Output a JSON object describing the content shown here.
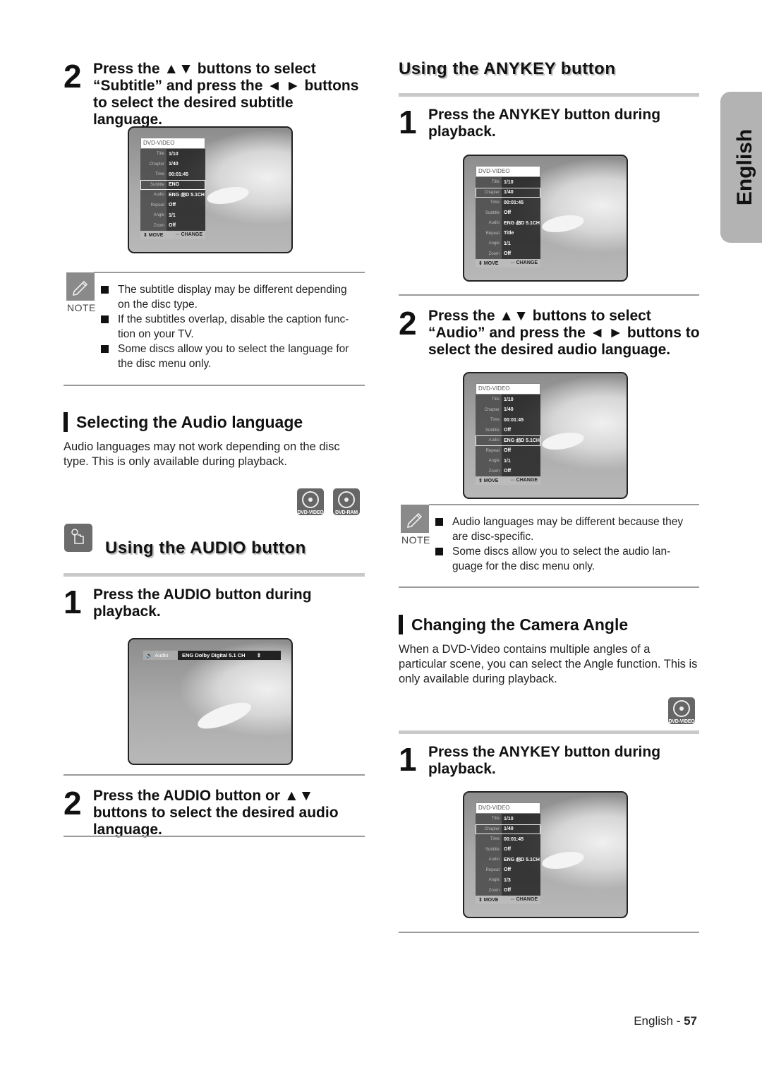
{
  "side_tab": {
    "label": "English"
  },
  "left_column": {
    "step2_subtitle": {
      "number": "2",
      "text": "Press the ▲▼ buttons to select “Subtitle” and press the ◄ ► buttons to select the desired subtitle language.",
      "osd": {
        "header": "DVD-VIDEO",
        "rows": [
          {
            "label": "Title",
            "value": "1/10"
          },
          {
            "label": "Chapter",
            "value": "1/40"
          },
          {
            "label": "Time",
            "value": "00:01:45"
          },
          {
            "label": "Subtitle",
            "value": "ENG",
            "selected": true
          },
          {
            "label": "Audio",
            "value": "ENG ㏈D 5.1CH"
          },
          {
            "label": "Repeat",
            "value": "Off"
          },
          {
            "label": "Angle",
            "value": "1/1"
          },
          {
            "label": "Zoom",
            "value": "Off"
          }
        ],
        "footer_move": "MOVE",
        "footer_change": "CHANGE"
      }
    },
    "note1": {
      "label": "NOTE",
      "items": [
        "The subtitle display may be different depending on the disc type.",
        "If the subtitles overlap, disable the caption func- tion on your TV.",
        "Some discs allow you to select the language for the disc menu only."
      ]
    },
    "audio_lang_section": {
      "title": "Selecting the Audio language",
      "body": "Audio languages may not work depending on the disc type. This is only available during playback.",
      "discs": [
        "DVD-VIDEO",
        "DVD-RAM"
      ]
    },
    "audio_button_section": {
      "title": "Using the AUDIO button",
      "step1": {
        "number": "1",
        "text": "Press the AUDIO button during playback."
      },
      "audio_osd": {
        "label": "Audio",
        "value": "ENG Dolby Digital 5.1 CH",
        "arrows": "⇕"
      },
      "step2": {
        "number": "2",
        "text": "Press the AUDIO button or ▲▼ buttons to select the desired audio language."
      }
    }
  },
  "right_column": {
    "anykey_section": {
      "title": "Using the ANYKEY button",
      "step1": {
        "number": "1",
        "text": "Press the ANYKEY button during playback."
      },
      "osd1": {
        "header": "DVD-VIDEO",
        "rows": [
          {
            "label": "Title",
            "value": "1/10"
          },
          {
            "label": "Chapter",
            "value": "1/40",
            "selected": true
          },
          {
            "label": "Time",
            "value": "00:01:45"
          },
          {
            "label": "Subtitle",
            "value": "Off"
          },
          {
            "label": "Audio",
            "value": "ENG ㏈D 5.1CH"
          },
          {
            "label": "Repeat",
            "value": "Title"
          },
          {
            "label": "Angle",
            "value": "1/1"
          },
          {
            "label": "Zoom",
            "value": "Off"
          }
        ],
        "footer_move": "MOVE",
        "footer_change": "CHANGE"
      },
      "step2": {
        "number": "2",
        "text": "Press the ▲▼ buttons to select “Audio” and press the ◄ ► buttons to select the desired audio language."
      },
      "osd2": {
        "header": "DVD-VIDEO",
        "rows": [
          {
            "label": "Title",
            "value": "1/10"
          },
          {
            "label": "Chapter",
            "value": "1/40"
          },
          {
            "label": "Time",
            "value": "00:01:45"
          },
          {
            "label": "Subtitle",
            "value": "Off"
          },
          {
            "label": "Audio",
            "value": "ENG ㏈D 5.1CH",
            "selected": true
          },
          {
            "label": "Repeat",
            "value": "Off"
          },
          {
            "label": "Angle",
            "value": "1/1"
          },
          {
            "label": "Zoom",
            "value": "Off"
          }
        ],
        "footer_move": "MOVE",
        "footer_change": "CHANGE"
      }
    },
    "note2": {
      "label": "NOTE",
      "items": [
        "Audio languages may be different because they are disc-specific.",
        "Some discs allow you to select the audio lan- guage for the disc menu only."
      ]
    },
    "angle_section": {
      "title": "Changing the Camera Angle",
      "body": "When a DVD-Video contains multiple angles of a particular scene, you can select the Angle function. This is only available during playback.",
      "discs": [
        "DVD-VIDEO"
      ],
      "step1": {
        "number": "1",
        "text": "Press the ANYKEY button during playback."
      },
      "osd": {
        "header": "DVD-VIDEO",
        "rows": [
          {
            "label": "Title",
            "value": "1/10"
          },
          {
            "label": "Chapter",
            "value": "1/40",
            "selected": true
          },
          {
            "label": "Time",
            "value": "00:01:45"
          },
          {
            "label": "Subtitle",
            "value": "Off"
          },
          {
            "label": "Audio",
            "value": "ENG ㏈D 5.1CH"
          },
          {
            "label": "Repeat",
            "value": "Off"
          },
          {
            "label": "Angle",
            "value": "1/3"
          },
          {
            "label": "Zoom",
            "value": "Off"
          }
        ],
        "footer_move": "MOVE",
        "footer_change": "CHANGE"
      }
    }
  },
  "footer": {
    "language": "English",
    "separator": " - ",
    "page": "57"
  }
}
